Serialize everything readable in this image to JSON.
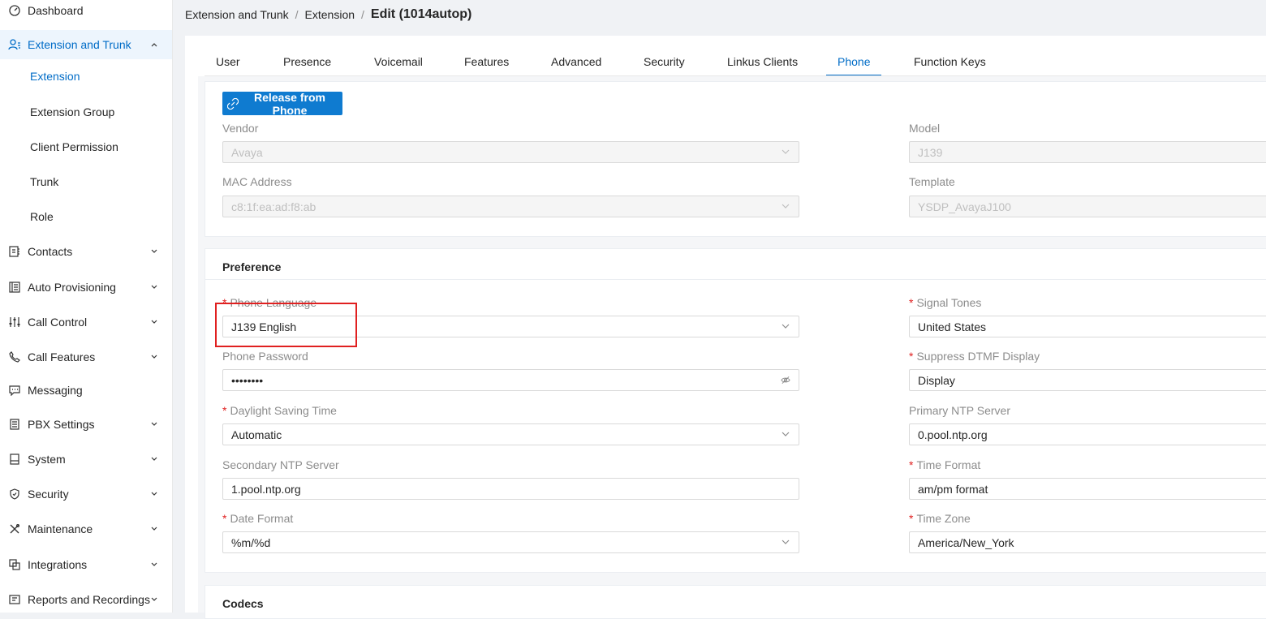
{
  "sidebar": {
    "items": [
      {
        "label": "Dashboard",
        "icon": "dashboard-icon"
      },
      {
        "label": "Extension and Trunk",
        "icon": "users-icon",
        "expanded": true,
        "children": [
          {
            "label": "Extension",
            "active": true
          },
          {
            "label": "Extension Group"
          },
          {
            "label": "Client Permission"
          },
          {
            "label": "Trunk"
          },
          {
            "label": "Role"
          }
        ]
      },
      {
        "label": "Contacts",
        "icon": "contacts-icon"
      },
      {
        "label": "Auto Provisioning",
        "icon": "provisioning-icon"
      },
      {
        "label": "Call Control",
        "icon": "call-control-icon"
      },
      {
        "label": "Call Features",
        "icon": "phone-icon"
      },
      {
        "label": "Messaging",
        "icon": "message-icon"
      },
      {
        "label": "PBX Settings",
        "icon": "settings-icon"
      },
      {
        "label": "System",
        "icon": "system-icon"
      },
      {
        "label": "Security",
        "icon": "shield-icon"
      },
      {
        "label": "Maintenance",
        "icon": "tools-icon"
      },
      {
        "label": "Integrations",
        "icon": "integrations-icon"
      },
      {
        "label": "Reports and Recordings",
        "icon": "reports-icon"
      }
    ]
  },
  "breadcrumb": {
    "items": [
      "Extension and Trunk",
      "Extension"
    ],
    "separator": "/",
    "current": "Edit (1014autop)"
  },
  "tabs": [
    "User",
    "Presence",
    "Voicemail",
    "Features",
    "Advanced",
    "Security",
    "Linkus Clients",
    "Phone",
    "Function Keys"
  ],
  "active_tab": "Phone",
  "phone": {
    "release_button": "Release from Phone",
    "vendor_label": "Vendor",
    "vendor_value": "Avaya",
    "model_label": "Model",
    "model_value": "J139",
    "mac_label": "MAC Address",
    "mac_value": "c8:1f:ea:ad:f8:ab",
    "template_label": "Template",
    "template_value": "YSDP_AvayaJ100"
  },
  "preference": {
    "title": "Preference",
    "required_mark": "*",
    "phone_language_label": "Phone Language",
    "phone_language_value": "J139 English",
    "signal_tones_label": "Signal Tones",
    "signal_tones_value": "United States",
    "phone_password_label": "Phone Password",
    "phone_password_value": "••••••••",
    "suppress_dtmf_label": "Suppress DTMF Display",
    "suppress_dtmf_value": "Display",
    "dst_label": "Daylight Saving Time",
    "dst_value": "Automatic",
    "primary_ntp_label": "Primary NTP Server",
    "primary_ntp_value": "0.pool.ntp.org",
    "secondary_ntp_label": "Secondary NTP Server",
    "secondary_ntp_value": "1.pool.ntp.org",
    "time_format_label": "Time Format",
    "time_format_value": "am/pm format",
    "date_format_label": "Date Format",
    "date_format_value": "%m/%d",
    "time_zone_label": "Time Zone",
    "time_zone_value": "America/New_York"
  },
  "codecs": {
    "title": "Codecs"
  },
  "colors": {
    "accent": "#006cc7",
    "button": "#0f7bd0",
    "required": "#e02020",
    "highlight": "#e02020"
  }
}
